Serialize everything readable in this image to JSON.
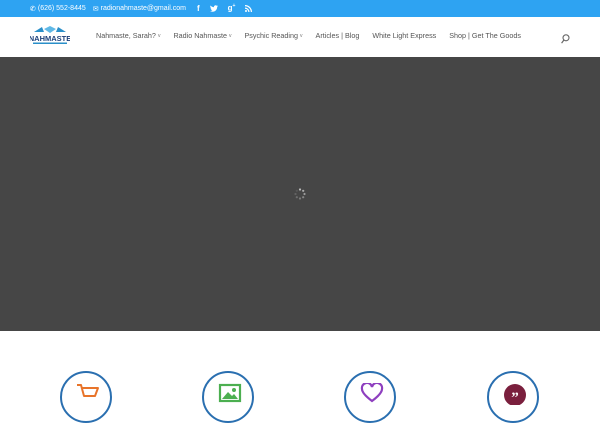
{
  "topbar": {
    "phone": "(626) 552-8445",
    "email": "radionahmaste@gmail.com",
    "social_icons": [
      "facebook-icon",
      "twitter-icon",
      "google-plus-icon",
      "rss-icon"
    ],
    "background_color": "#2ea3f2"
  },
  "logo": {
    "text": "NAHMASTE"
  },
  "nav": {
    "items": [
      {
        "label": "Nahmaste, Sarah?",
        "has_submenu": true
      },
      {
        "label": "Radio Nahmaste",
        "has_submenu": true
      },
      {
        "label": "Psychic Reading",
        "has_submenu": true
      },
      {
        "label": "Articles | Blog",
        "has_submenu": false
      },
      {
        "label": "White Light Express",
        "has_submenu": false
      },
      {
        "label": "Shop | Get The Goods",
        "has_submenu": false
      }
    ],
    "chevron": "v"
  },
  "hero": {
    "background_color": "#464646",
    "state": "loading"
  },
  "features": {
    "icons": [
      "cart-icon",
      "image-icon",
      "heart-icon",
      "quote-icon"
    ],
    "icon_colors": [
      "#e8742a",
      "#4caf50",
      "#8e3fbf",
      "#7a1f3d"
    ],
    "ring_color": "#2a6fb0"
  }
}
